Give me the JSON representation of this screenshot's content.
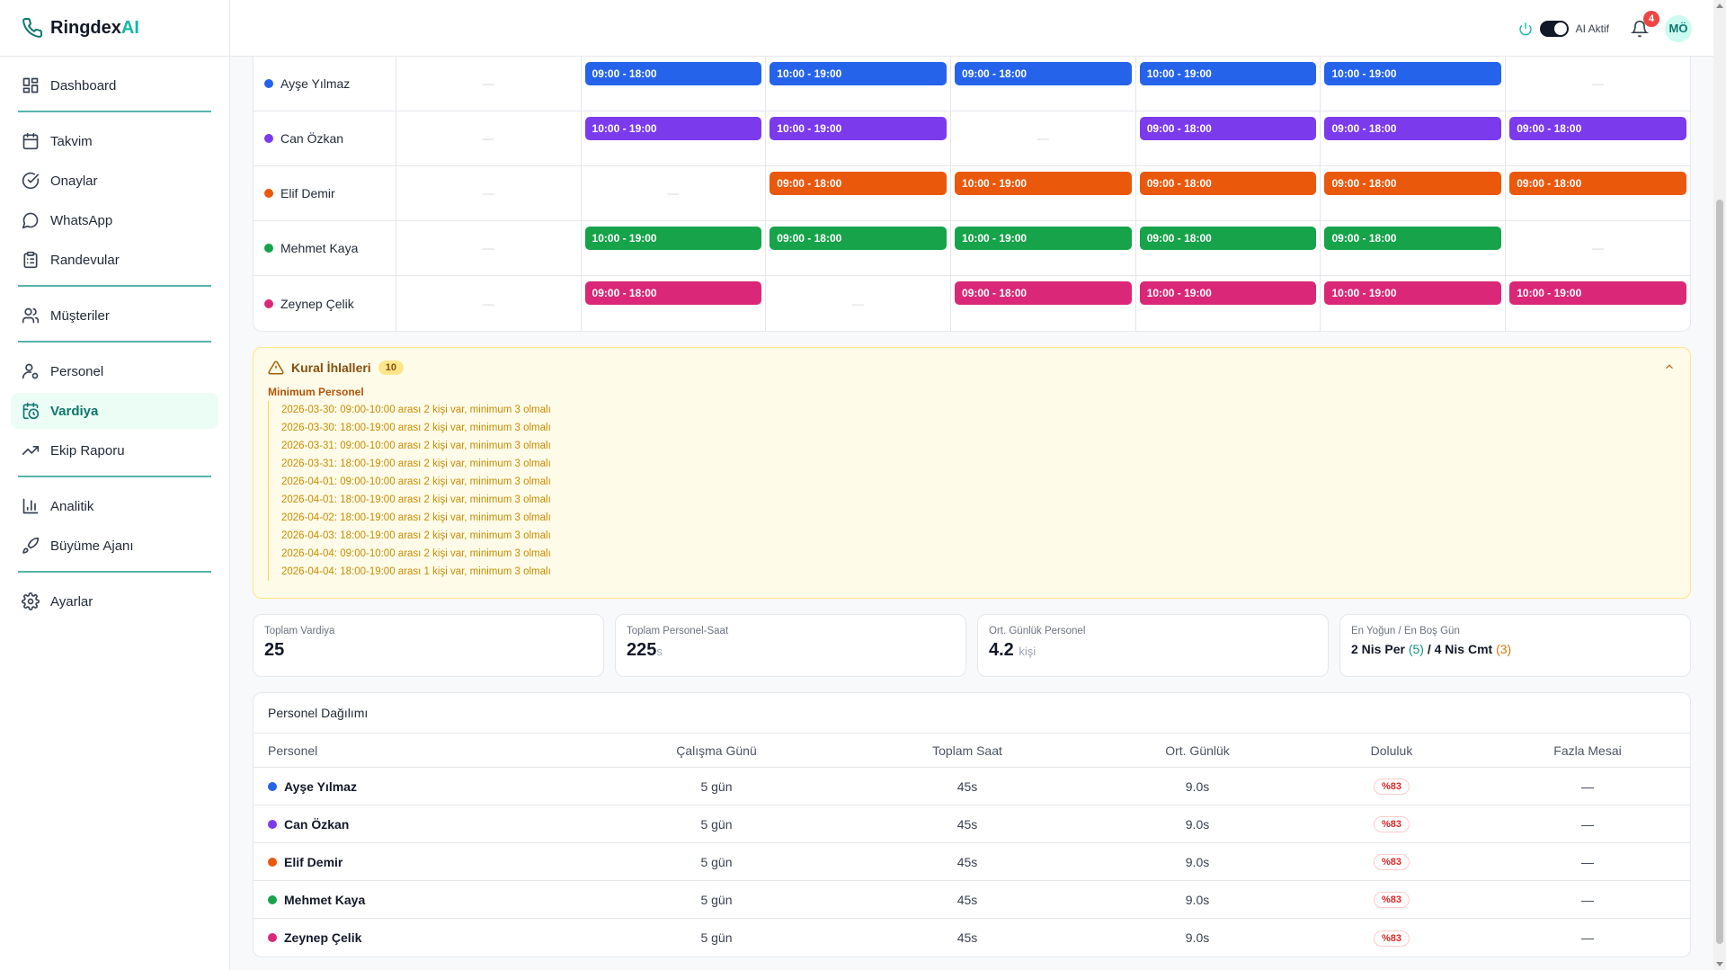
{
  "brand": {
    "name": "Ringdex",
    "accent": "AI"
  },
  "sidebar": {
    "items": [
      {
        "label": "Dashboard",
        "icon": "grid-icon"
      },
      {
        "label": "Takvim",
        "icon": "calendar-icon"
      },
      {
        "label": "Onaylar",
        "icon": "check-circle-icon"
      },
      {
        "label": "WhatsApp",
        "icon": "chat-icon"
      },
      {
        "label": "Randevular",
        "icon": "clipboard-icon"
      },
      {
        "label": "Müşteriler",
        "icon": "users-icon"
      },
      {
        "label": "Personel",
        "icon": "user-cog-icon"
      },
      {
        "label": "Vardiya",
        "icon": "calendar-clock-icon"
      },
      {
        "label": "Ekip Raporu",
        "icon": "trending-up-icon"
      },
      {
        "label": "Analitik",
        "icon": "bar-chart-icon"
      },
      {
        "label": "Büyüme Ajanı",
        "icon": "rocket-icon"
      },
      {
        "label": "Ayarlar",
        "icon": "gear-icon"
      }
    ],
    "active": "Vardiya"
  },
  "header": {
    "ai_label": "AI Aktif",
    "notifications": "4",
    "avatar": "MÖ"
  },
  "colors": {
    "blue": "#2563eb",
    "purple": "#7c3aed",
    "orange": "#ea580c",
    "green": "#16a34a",
    "pink": "#db2777",
    "teal": "#14b8a6"
  },
  "schedule": {
    "dash": "—",
    "rows": [
      {
        "name": "Ayşe Yılmaz",
        "color": "#2563eb",
        "shifts": [
          "",
          "09:00 - 18:00",
          "10:00 - 19:00",
          "09:00 - 18:00",
          "10:00 - 19:00",
          "10:00 - 19:00",
          ""
        ]
      },
      {
        "name": "Can Özkan",
        "color": "#7c3aed",
        "shifts": [
          "",
          "10:00 - 19:00",
          "10:00 - 19:00",
          "",
          "09:00 - 18:00",
          "09:00 - 18:00",
          "09:00 - 18:00"
        ]
      },
      {
        "name": "Elif Demir",
        "color": "#ea580c",
        "shifts": [
          "",
          "",
          "09:00 - 18:00",
          "10:00 - 19:00",
          "09:00 - 18:00",
          "09:00 - 18:00",
          "09:00 - 18:00"
        ]
      },
      {
        "name": "Mehmet Kaya",
        "color": "#16a34a",
        "shifts": [
          "",
          "10:00 - 19:00",
          "09:00 - 18:00",
          "10:00 - 19:00",
          "09:00 - 18:00",
          "09:00 - 18:00",
          ""
        ]
      },
      {
        "name": "Zeynep Çelik",
        "color": "#db2777",
        "shifts": [
          "",
          "09:00 - 18:00",
          "",
          "09:00 - 18:00",
          "10:00 - 19:00",
          "10:00 - 19:00",
          "10:00 - 19:00"
        ]
      }
    ]
  },
  "violations": {
    "title": "Kural İhlalleri",
    "count": "10",
    "category": "Minimum Personel",
    "items": [
      "2026-03-30: 09:00-10:00 arası 2 kişi var, minimum 3 olmalı",
      "2026-03-30: 18:00-19:00 arası 2 kişi var, minimum 3 olmalı",
      "2026-03-31: 09:00-10:00 arası 2 kişi var, minimum 3 olmalı",
      "2026-03-31: 18:00-19:00 arası 2 kişi var, minimum 3 olmalı",
      "2026-04-01: 09:00-10:00 arası 2 kişi var, minimum 3 olmalı",
      "2026-04-01: 18:00-19:00 arası 2 kişi var, minimum 3 olmalı",
      "2026-04-02: 18:00-19:00 arası 2 kişi var, minimum 3 olmalı",
      "2026-04-03: 18:00-19:00 arası 2 kişi var, minimum 3 olmalı",
      "2026-04-04: 09:00-10:00 arası 2 kişi var, minimum 3 olmalı",
      "2026-04-04: 18:00-19:00 arası 1 kişi var, minimum 3 olmalı"
    ]
  },
  "stats": {
    "total_shifts": {
      "label": "Toplam Vardiya",
      "value": "25"
    },
    "total_hours": {
      "label": "Toplam Personel-Saat",
      "value": "225",
      "unit": "s"
    },
    "avg_daily": {
      "label": "Ort. Günlük Personel",
      "value": "4.2",
      "unit": "kişi"
    },
    "busiest": {
      "label": "En Yoğun / En Boş Gün",
      "busy_day": "2 Nis Per",
      "busy_count": "(5)",
      "sep": " / ",
      "quiet_day": "4 Nis Cmt",
      "quiet_count": "(3)"
    }
  },
  "distribution": {
    "title": "Personel Dağılımı",
    "headers": [
      "Personel",
      "Çalışma Günü",
      "Toplam Saat",
      "Ort. Günlük",
      "Doluluk",
      "Fazla Mesai"
    ],
    "rows": [
      {
        "name": "Ayşe Yılmaz",
        "color": "#2563eb",
        "days": "5 gün",
        "hours": "45s",
        "avg": "9.0s",
        "fill": "%83",
        "overtime": "—"
      },
      {
        "name": "Can Özkan",
        "color": "#7c3aed",
        "days": "5 gün",
        "hours": "45s",
        "avg": "9.0s",
        "fill": "%83",
        "overtime": "—"
      },
      {
        "name": "Elif Demir",
        "color": "#ea580c",
        "days": "5 gün",
        "hours": "45s",
        "avg": "9.0s",
        "fill": "%83",
        "overtime": "—"
      },
      {
        "name": "Mehmet Kaya",
        "color": "#16a34a",
        "days": "5 gün",
        "hours": "45s",
        "avg": "9.0s",
        "fill": "%83",
        "overtime": "—"
      },
      {
        "name": "Zeynep Çelik",
        "color": "#db2777",
        "days": "5 gün",
        "hours": "45s",
        "avg": "9.0s",
        "fill": "%83",
        "overtime": "—"
      }
    ]
  }
}
